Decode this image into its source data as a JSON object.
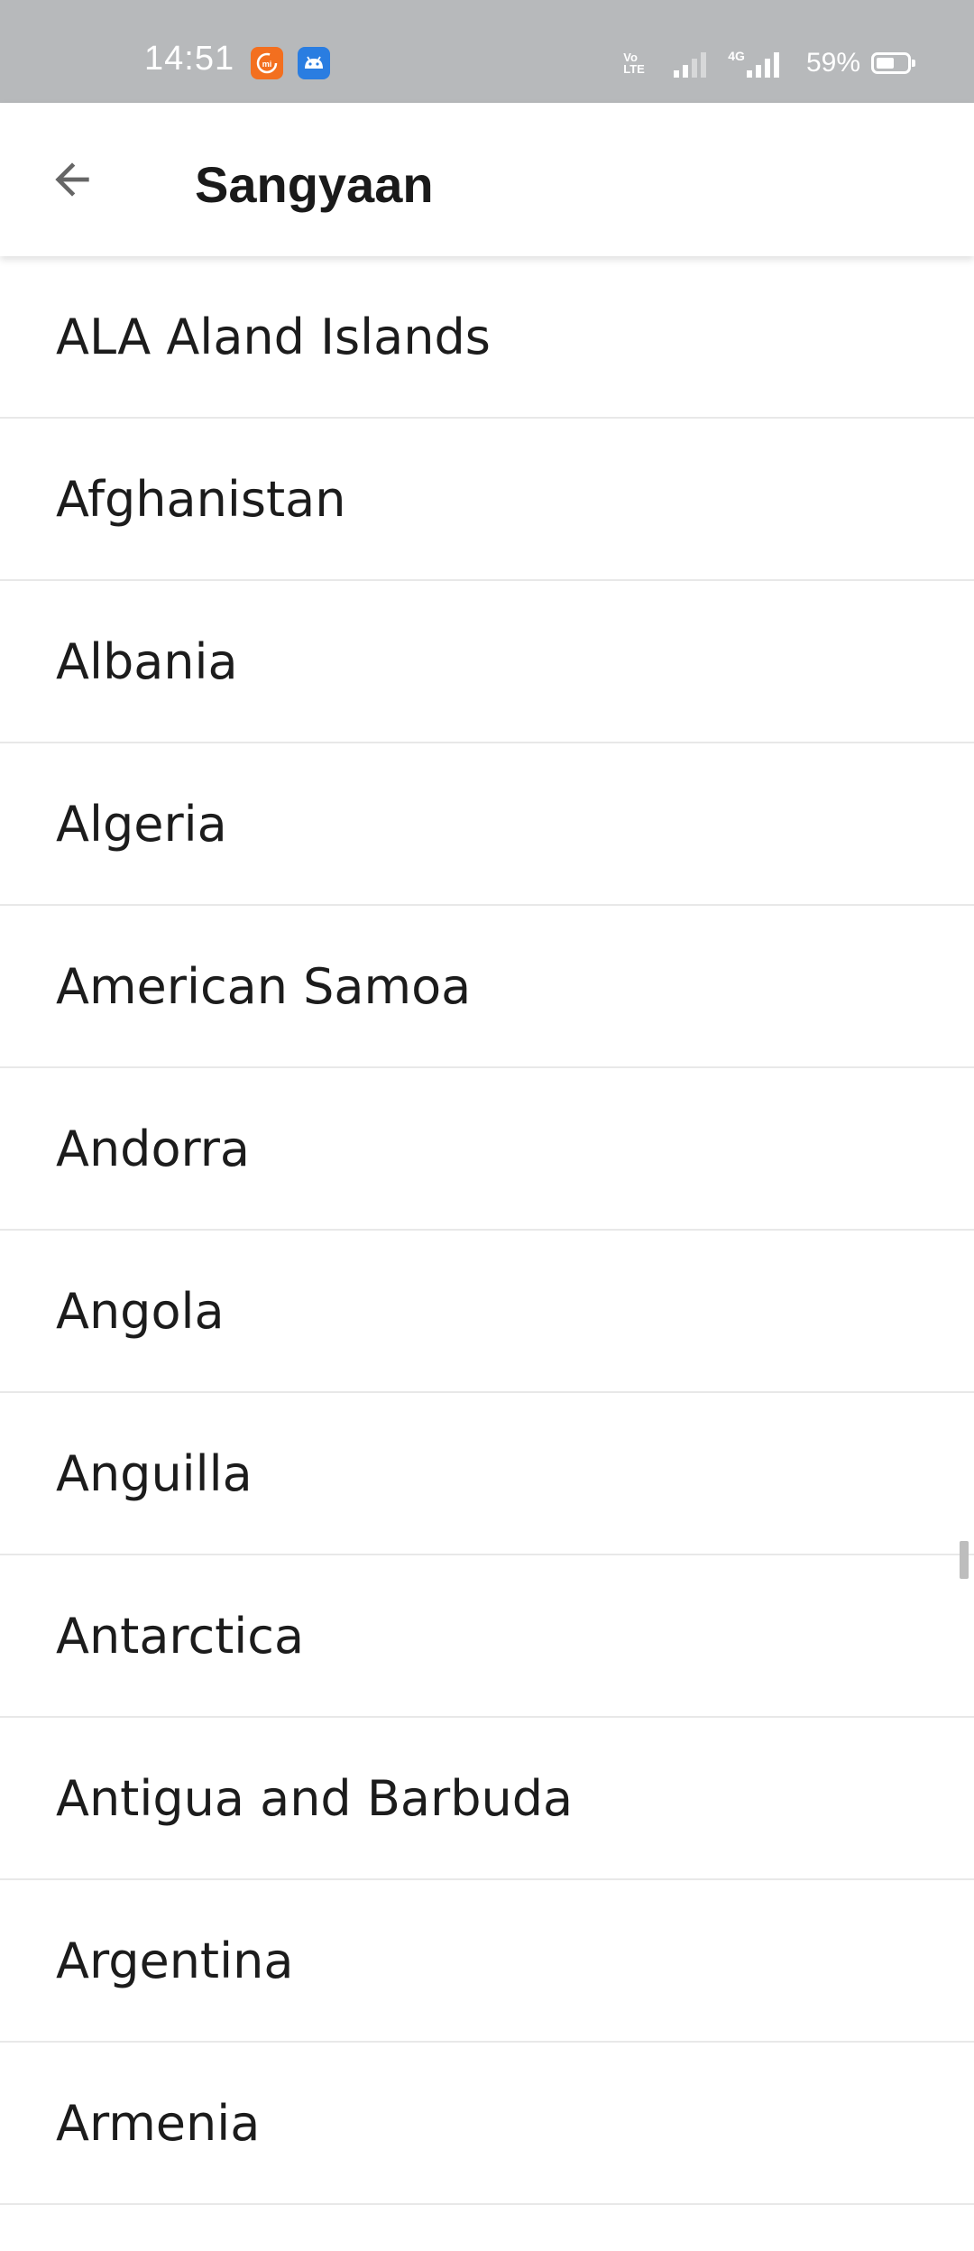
{
  "status_bar": {
    "time": "14:51",
    "volte_label": "Vo LTE",
    "network_label": "4G",
    "battery_percent": "59%",
    "battery_level": 0.59,
    "notification_icons": [
      "mi-app-icon",
      "android-app-icon"
    ]
  },
  "app_bar": {
    "title": "Sangyaan",
    "back_icon": "arrow-left-icon"
  },
  "countries": [
    "ALA Aland Islands",
    "Afghanistan",
    "Albania",
    "Algeria",
    "American Samoa",
    "Andorra",
    "Angola",
    "Anguilla",
    "Antarctica",
    "Antigua and Barbuda",
    "Argentina",
    "Armenia"
  ],
  "colors": {
    "status_bar_bg": "#b7b9bb",
    "mi_icon": "#f36f1f",
    "android_icon": "#2a7de1",
    "divider": "#e8e8e8"
  }
}
